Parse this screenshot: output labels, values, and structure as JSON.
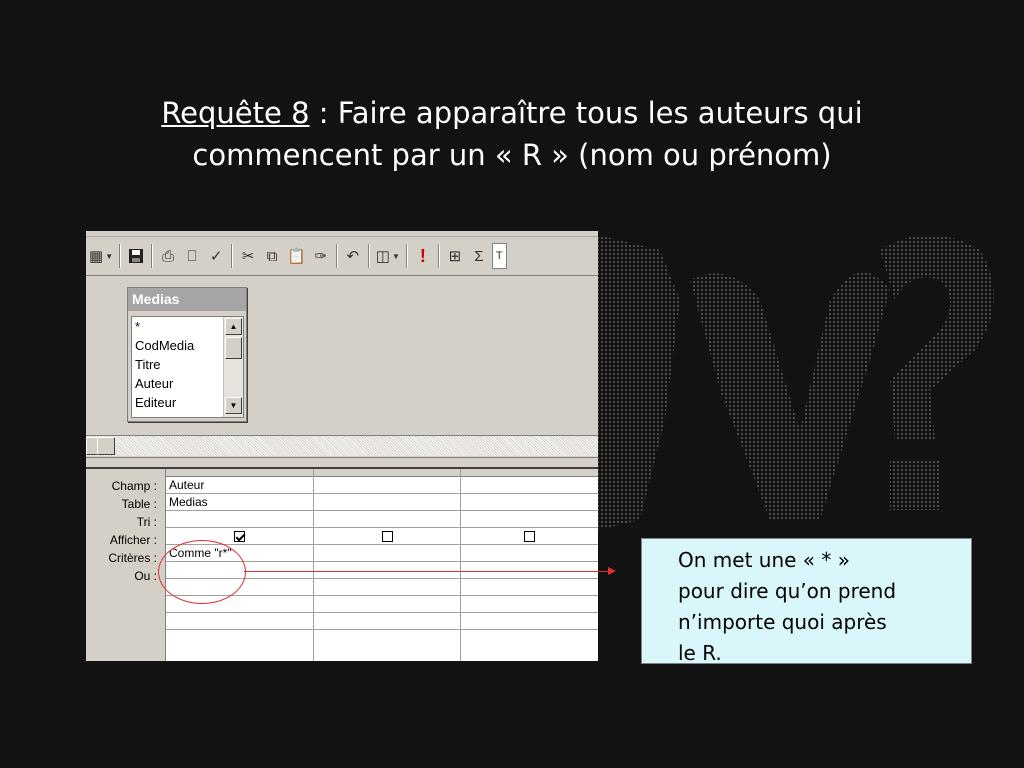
{
  "slide": {
    "title_number": "Requête 8",
    "title_rest": " : Faire apparaître tous les auteurs qui",
    "title_line2": "commencent par un « R » (nom ou prénom)"
  },
  "toolbar": {
    "icons": [
      "datasheet-view-icon",
      "save-icon",
      "print-icon",
      "print-preview-icon",
      "spelling-icon",
      "cut-icon",
      "copy-icon",
      "paste-icon",
      "format-painter-icon",
      "undo-icon",
      "query-type-icon",
      "run-icon",
      "show-table-icon",
      "totals-icon"
    ],
    "run_glyph": "!",
    "totals_glyph": "Σ",
    "top_values_text": "T"
  },
  "field_list": {
    "title": "Medias",
    "items": [
      "*",
      "CodMedia",
      "Titre",
      "Auteur",
      "Editeur"
    ]
  },
  "grid": {
    "row_labels": [
      "Champ :",
      "Table :",
      "Tri :",
      "Afficher :",
      "Critères :",
      "Ou :"
    ],
    "columns": [
      {
        "champ": "Auteur",
        "table": "Medias",
        "tri": "",
        "afficher": true,
        "criteres": "Comme \"r*\"",
        "ou": ""
      },
      {
        "champ": "",
        "table": "",
        "tri": "",
        "afficher": false,
        "criteres": "",
        "ou": ""
      },
      {
        "champ": "",
        "table": "",
        "tri": "",
        "afficher": false,
        "criteres": "",
        "ou": ""
      }
    ]
  },
  "callout": {
    "lines": [
      "On met une « * »",
      "pour dire qu’on prend",
      "n’importe quoi après",
      "le R."
    ]
  },
  "colors": {
    "background": "#121212",
    "title_text": "#ffffff",
    "annotation_red": "#e03030",
    "callout_bg": "#d9f7fb",
    "window_face": "#d4d0c8"
  }
}
